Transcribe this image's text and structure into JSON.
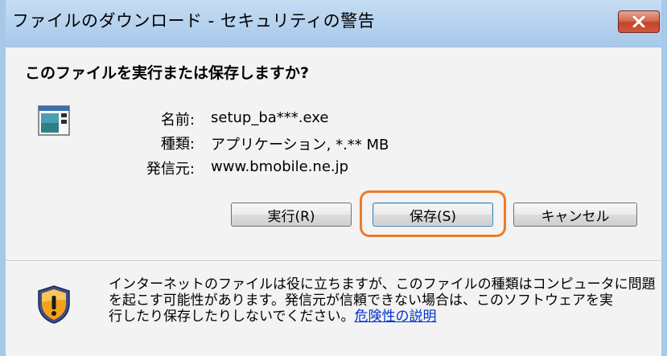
{
  "window": {
    "title": "ファイルのダウンロード - セキュリティの警告"
  },
  "dialog": {
    "question": "このファイルを実行または保存しますか?",
    "file_icon": "application-window-icon",
    "info": {
      "name_label": "名前:",
      "name_value": "setup_ba***.exe",
      "type_label": "種類:",
      "type_value": "アプリケーション, *.** MB",
      "from_label": "発信元:",
      "from_value": "www.bmobile.ne.jp"
    },
    "buttons": {
      "run": "実行(R)",
      "save": "保存(S)",
      "cancel": "キャンセル"
    },
    "warning": {
      "icon": "security-shield-icon",
      "line1": "インターネットのファイルは役に立ちますが、このファイルの種類はコンピュータに問題",
      "line2": "を起こす可能性があります。発信元が信頼できない場合は、このソフトウェアを実",
      "line3_prefix": "行したり保存したりしないでください。",
      "link_text": "危険性の説明"
    }
  },
  "colors": {
    "titlebar": "#b4d1ee",
    "close_button": "#c2442b",
    "highlight_ring": "#f07a24",
    "link": "#0033cc",
    "shield_orange": "#f4a21c"
  }
}
